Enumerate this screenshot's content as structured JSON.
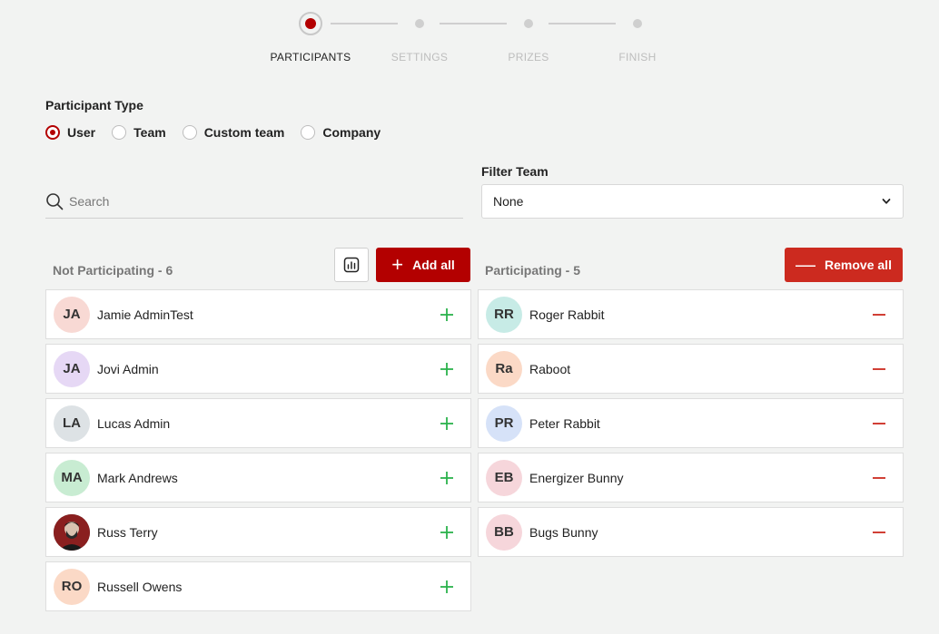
{
  "stepper": {
    "steps": [
      {
        "label": "PARTICIPANTS",
        "active": true
      },
      {
        "label": "SETTINGS",
        "active": false
      },
      {
        "label": "PRIZES",
        "active": false
      },
      {
        "label": "FINISH",
        "active": false
      }
    ]
  },
  "participant_type": {
    "title": "Participant Type",
    "options": [
      {
        "label": "User",
        "checked": true
      },
      {
        "label": "Team",
        "checked": false
      },
      {
        "label": "Custom team",
        "checked": false
      },
      {
        "label": "Company",
        "checked": false
      }
    ]
  },
  "search": {
    "placeholder": "Search",
    "icon": "search-icon"
  },
  "filter_team": {
    "label": "Filter Team",
    "value": "None",
    "icon": "chevron-down-icon"
  },
  "not_participating": {
    "title": "Not Participating - 6",
    "chart_button_icon": "chart-icon",
    "add_all_label": "Add all",
    "items": [
      {
        "initials": "JA",
        "name": "Jamie AdminTest",
        "avatar_color": "#f8d9d4"
      },
      {
        "initials": "JA",
        "name": "Jovi Admin",
        "avatar_color": "#e6d8f5"
      },
      {
        "initials": "LA",
        "name": "Lucas Admin",
        "avatar_color": "#dde2e5"
      },
      {
        "initials": "MA",
        "name": "Mark Andrews",
        "avatar_color": "#c8ecd2"
      },
      {
        "initials": "",
        "name": "Russ Terry",
        "avatar_color": "#3a2a2a",
        "photo": true
      },
      {
        "initials": "RO",
        "name": "Russell Owens",
        "avatar_color": "#fbd9c6"
      }
    ]
  },
  "participating": {
    "title": "Participating - 5",
    "remove_all_label": "Remove all",
    "items": [
      {
        "initials": "RR",
        "name": "Roger Rabbit",
        "avatar_color": "#c7ebe6"
      },
      {
        "initials": "Ra",
        "name": "Raboot",
        "avatar_color": "#fbd9c6"
      },
      {
        "initials": "PR",
        "name": "Peter Rabbit",
        "avatar_color": "#d6e2f8"
      },
      {
        "initials": "EB",
        "name": "Energizer Bunny",
        "avatar_color": "#f6d6db"
      },
      {
        "initials": "BB",
        "name": "Bugs Bunny",
        "avatar_color": "#f6d6db"
      }
    ]
  },
  "colors": {
    "accent": "#b30000",
    "remove": "#cc2a1f",
    "add_icon": "#2bb24c",
    "remove_icon": "#cc2a1f"
  }
}
